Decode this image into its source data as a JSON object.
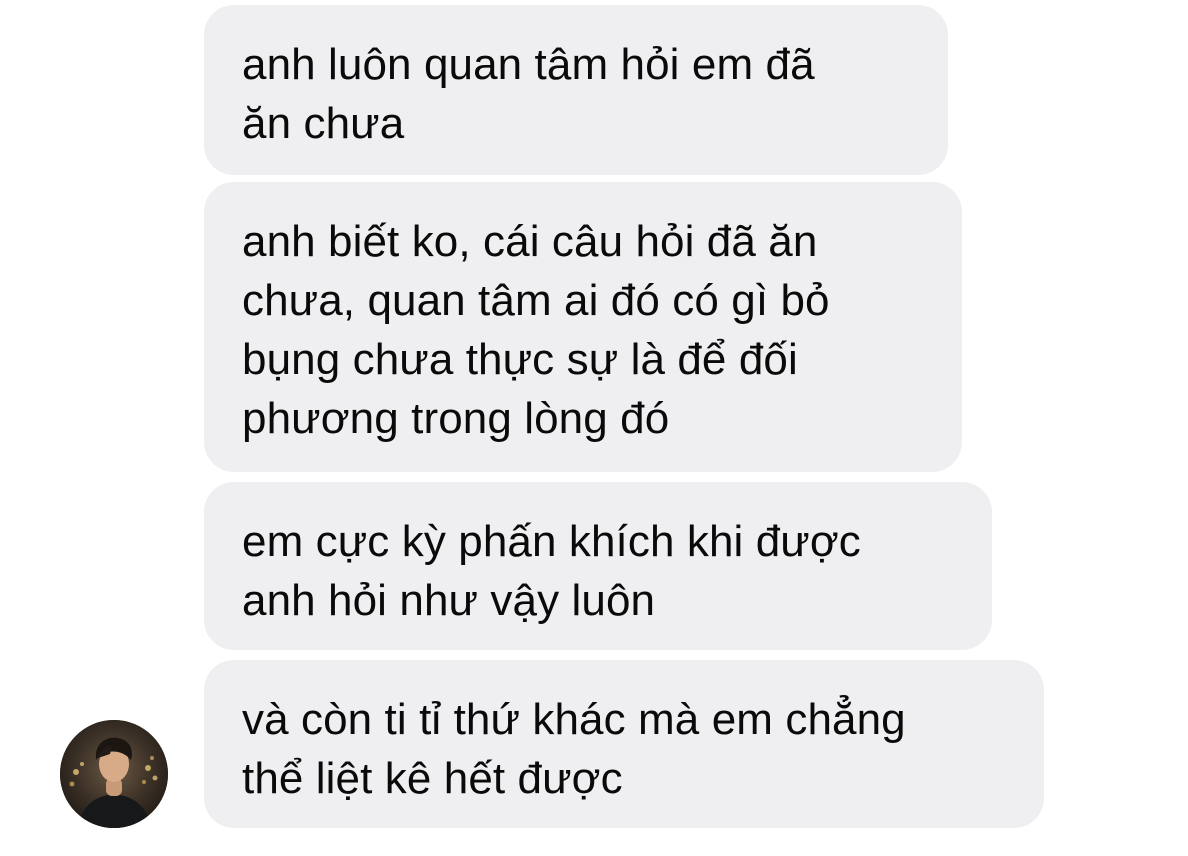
{
  "messages": [
    {
      "lines": [
        "anh luôn quan tâm hỏi em đã",
        "ăn chưa"
      ]
    },
    {
      "lines": [
        "anh biết ko, cái câu hỏi đã ăn",
        "chưa, quan tâm ai đó có gì bỏ",
        "bụng chưa thực sự là để đối",
        "phương trong lòng đó"
      ]
    },
    {
      "lines": [
        "em cực kỳ phấn khích khi được",
        "anh hỏi như vậy luôn"
      ]
    },
    {
      "lines": [
        "và còn ti tỉ thứ khác mà em chẳng",
        "thể liệt kê hết được"
      ]
    }
  ],
  "colors": {
    "bubble_background": "#efeff1",
    "text": "#0a0a0a",
    "page_background": "#ffffff"
  },
  "avatar": {
    "icon": "profile-photo-icon"
  }
}
